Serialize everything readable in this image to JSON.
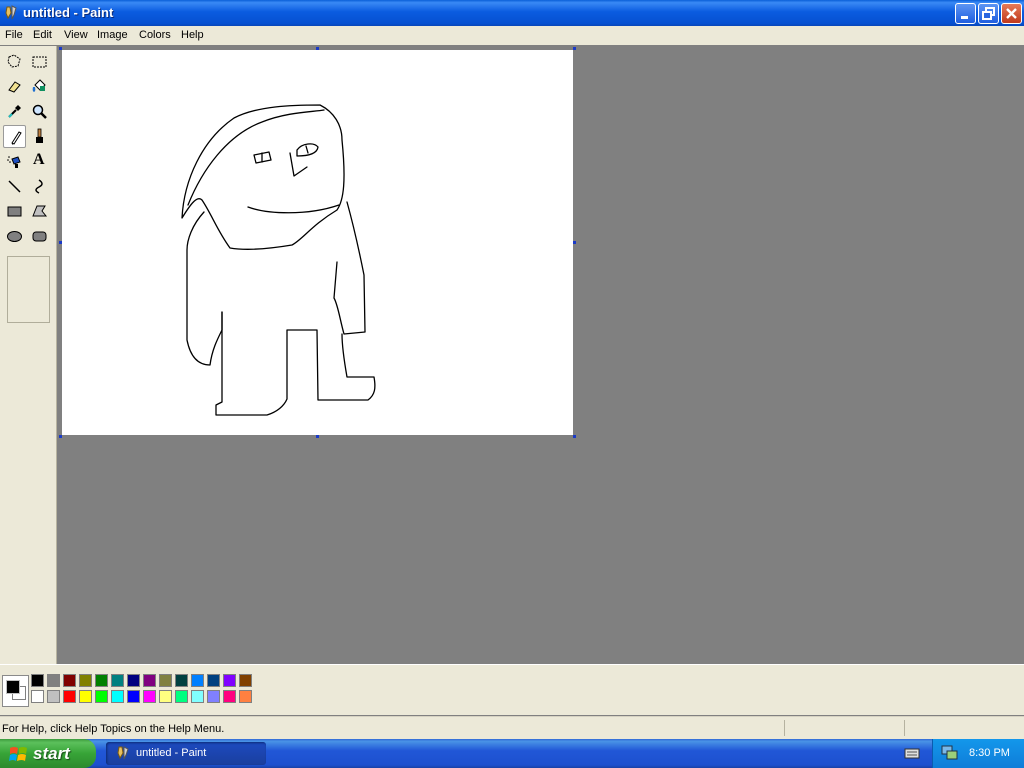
{
  "window": {
    "title": "untitled - Paint"
  },
  "menu": {
    "items": [
      "File",
      "Edit",
      "View",
      "Image",
      "Colors",
      "Help"
    ]
  },
  "toolbox": {
    "tools": [
      {
        "name": "free-form-select-icon"
      },
      {
        "name": "select-icon"
      },
      {
        "name": "eraser-icon"
      },
      {
        "name": "fill-with-color-icon"
      },
      {
        "name": "pick-color-icon"
      },
      {
        "name": "magnifier-icon"
      },
      {
        "name": "pencil-icon",
        "selected": true
      },
      {
        "name": "brush-icon"
      },
      {
        "name": "airbrush-icon"
      },
      {
        "name": "text-icon",
        "label": "A"
      },
      {
        "name": "line-icon"
      },
      {
        "name": "curve-icon"
      },
      {
        "name": "rectangle-icon"
      },
      {
        "name": "polygon-icon"
      },
      {
        "name": "ellipse-icon"
      },
      {
        "name": "rounded-rectangle-icon"
      }
    ]
  },
  "palette": {
    "foreground": "#000000",
    "background": "#ffffff",
    "row1": [
      "#000000",
      "#808080",
      "#800000",
      "#808000",
      "#008000",
      "#008080",
      "#000080",
      "#800080",
      "#808040",
      "#004040",
      "#0080ff",
      "#004080",
      "#8000ff",
      "#804000"
    ],
    "row2": [
      "#ffffff",
      "#c0c0c0",
      "#ff0000",
      "#ffff00",
      "#00ff00",
      "#00ffff",
      "#0000ff",
      "#ff00ff",
      "#ffff80",
      "#00ff80",
      "#80ffff",
      "#8080ff",
      "#ff0080",
      "#ff8040"
    ]
  },
  "status": {
    "help_text": "For Help, click Help Topics on the Help Menu."
  },
  "taskbar": {
    "start_label": "start",
    "task_label": "untitled - Paint",
    "clock": "8:30 PM"
  }
}
